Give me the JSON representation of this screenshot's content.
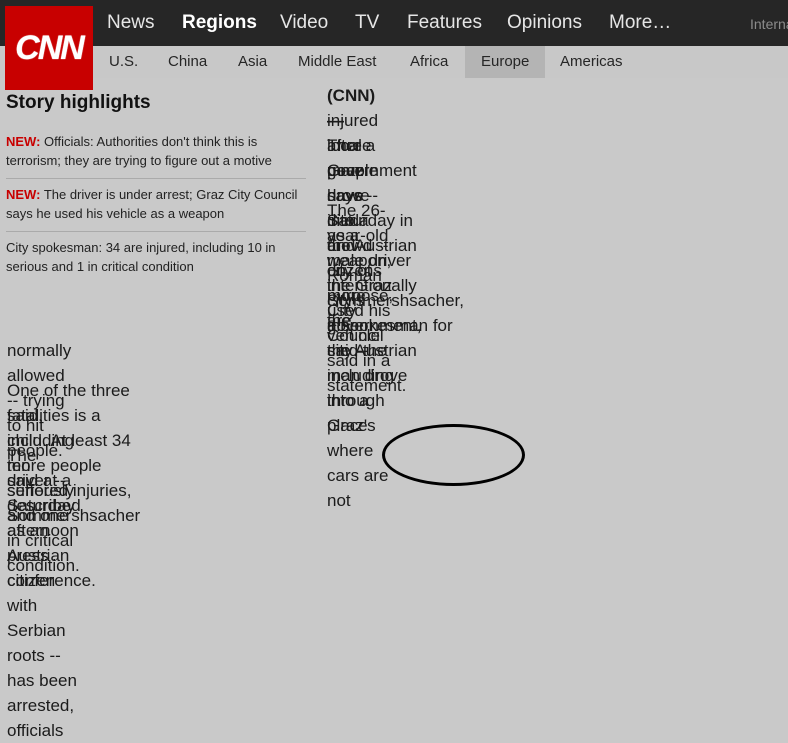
{
  "brand": {
    "logo_text": "CNN",
    "color": "#c80000"
  },
  "nav": {
    "items": [
      "News",
      "Regions",
      "Video",
      "TV",
      "Features",
      "Opinions",
      "More…"
    ],
    "active": "Regions",
    "edition_partial": "Interna"
  },
  "subnav": {
    "items": [
      "U.S.",
      "China",
      "Asia",
      "Middle East",
      "Africa",
      "Europe",
      "Americas"
    ],
    "active": "Europe"
  },
  "highlights": {
    "title": "Story highlights",
    "items": [
      {
        "tag": "NEW:",
        "text": " Officials: Authorities don't think this is terrorism; they are trying to figure out a motive"
      },
      {
        "tag": "NEW:",
        "text": " The driver is under arrest; Graz City Council says he used his vehicle as a weapon"
      },
      {
        "tag": "",
        "text": "City spokesman: 34 are injured, including 10 in serious and 1 in critical condition"
      }
    ]
  },
  "article": {
    "lead_tag": "(CNN)—",
    "p1_line1": "Three people have died and dozens more are",
    "p1_line2": "injured after a man drove into a crowd -- on purpose, the",
    "p1_line3": "local government says -- Saturday in the Austrian city of",
    "p1_line4": "Graz.",
    "p2_line1": "The 26-year-old male driver intentionally used his vehicle",
    "p2_line2": "as a weapon, the Graz City Council said in a statement.",
    "p3_line1": "Roman Sommershsacher, a spokesman for the Austrian",
    "p3_line2": "city's government, said the man drove through Graz's",
    "p3_line3": "inner city -- including into a place where cars are not",
    "p3_line4": "normally allowed -- trying to hit people.",
    "p4_line1": "One of the three fatalities is a child. At least 34 more people suffered injuries, Sommershsacher",
    "p4_line2": "said, including ten seriously and one in critical condition.",
    "p5_line1": "The driver -- described as an Austrian citizen with Serbian roots -- has been arrested, officials",
    "p5_line2": "said at a Saturday afternoon press conference."
  }
}
